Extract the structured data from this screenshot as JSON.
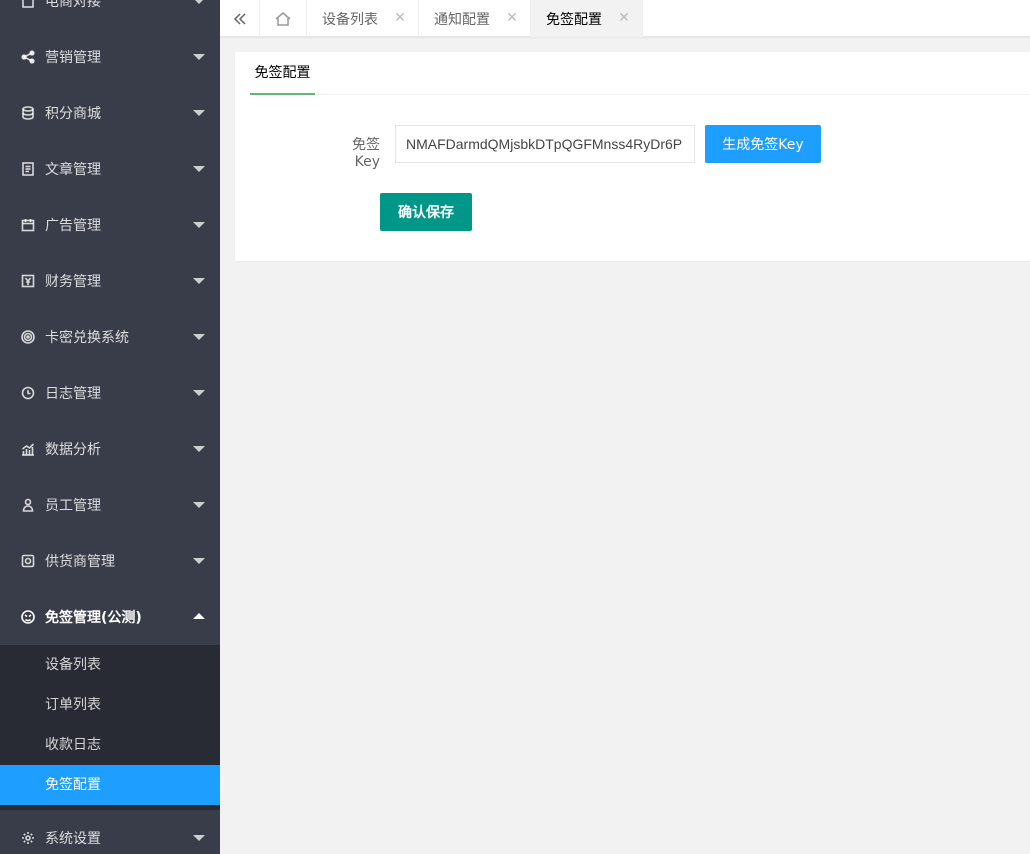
{
  "sidebar": {
    "items": [
      {
        "label": "电商对接",
        "icon": "document-icon"
      },
      {
        "label": "营销管理",
        "icon": "share-icon"
      },
      {
        "label": "积分商城",
        "icon": "database-icon"
      },
      {
        "label": "文章管理",
        "icon": "article-icon"
      },
      {
        "label": "广告管理",
        "icon": "calendar-icon"
      },
      {
        "label": "财务管理",
        "icon": "yen-icon"
      },
      {
        "label": "卡密兑换系统",
        "icon": "target-icon"
      },
      {
        "label": "日志管理",
        "icon": "clock-icon"
      },
      {
        "label": "数据分析",
        "icon": "chart-icon"
      },
      {
        "label": "员工管理",
        "icon": "user-icon"
      },
      {
        "label": "供货商管理",
        "icon": "supplier-icon"
      },
      {
        "label": "免签管理(公测)",
        "icon": "face-icon"
      },
      {
        "label": "系统设置",
        "icon": "gear-icon"
      }
    ],
    "sub_items": [
      "设备列表",
      "订单列表",
      "收款日志",
      "免签配置"
    ],
    "active_sub": "免签配置"
  },
  "tabs": [
    {
      "label": "设备列表",
      "close": "✕"
    },
    {
      "label": "通知配置",
      "close": "✕"
    },
    {
      "label": "免签配置",
      "close": "✕"
    }
  ],
  "content": {
    "tab_label": "免签配置",
    "key_label": "免签Key",
    "key_value": "NMAFDarmdQMjsbkDTpQGFMnss4RyDr6P",
    "generate_label": "生成免签Key",
    "save_label": "确认保存"
  },
  "colors": {
    "sidebar_bg": "#393d49",
    "submenu_bg": "#282b33",
    "active_blue": "#1e9fff",
    "save_green": "#009688",
    "tab_underline": "#5fb878"
  }
}
